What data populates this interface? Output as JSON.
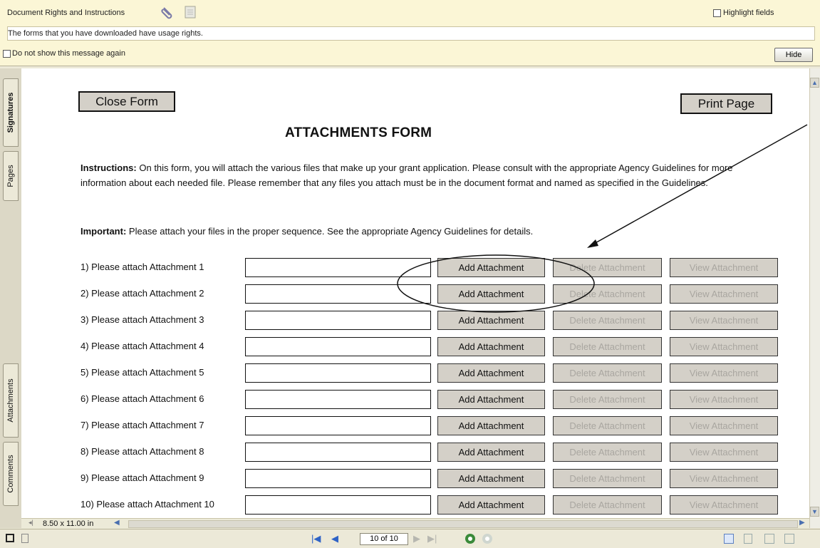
{
  "message_bar": {
    "title": "Document Rights and Instructions",
    "message": "The forms that you have downloaded have usage rights.",
    "dont_show_label": "Do not show this message again",
    "highlight_label": "Highlight fields",
    "hide_label": "Hide"
  },
  "side_tabs": [
    "Signatures",
    "Pages",
    "Attachments",
    "Comments"
  ],
  "form": {
    "close_label": "Close Form",
    "print_label": "Print Page",
    "title": "ATTACHMENTS FORM",
    "instructions_bold": "Instructions:",
    "instructions_text": "On this form, you will attach the various files that make up your grant application. Please consult with the appropriate Agency Guidelines for more information about each needed file. Please remember that any files you attach must be in the document format and named as specified in the Guidelines.",
    "important_bold": "Important:",
    "important_text": "Please attach your files in the proper sequence. See the appropriate Agency Guidelines for details.",
    "add_label": "Add Attachment",
    "delete_label": "Delete Attachment",
    "view_label": "View Attachment",
    "rows": [
      "1) Please attach Attachment 1",
      "2) Please attach Attachment 2",
      "3) Please attach Attachment 3",
      "4) Please attach Attachment 4",
      "5) Please attach Attachment 5",
      "6) Please attach Attachment 6",
      "7) Please attach Attachment 7",
      "8) Please attach Attachment 8",
      "9) Please attach Attachment 9",
      "10) Please attach Attachment 10"
    ]
  },
  "status": {
    "page_size": "8.50 x 11.00 in",
    "page_indicator": "10 of 10"
  },
  "icons": {
    "attachment": "paperclip-icon",
    "document": "document-icon",
    "first_page": "first-page-icon",
    "prev_page": "previous-page-icon",
    "next_page": "next-page-icon",
    "last_page": "last-page-icon",
    "go_back": "go-back-icon",
    "go_forward": "go-forward-icon"
  },
  "colors": {
    "message_bar_bg": "#fbf6d6",
    "chrome_bg": "#ece9d8",
    "nav_blue": "#2f63c6",
    "button_gray": "#d4d0c8"
  }
}
